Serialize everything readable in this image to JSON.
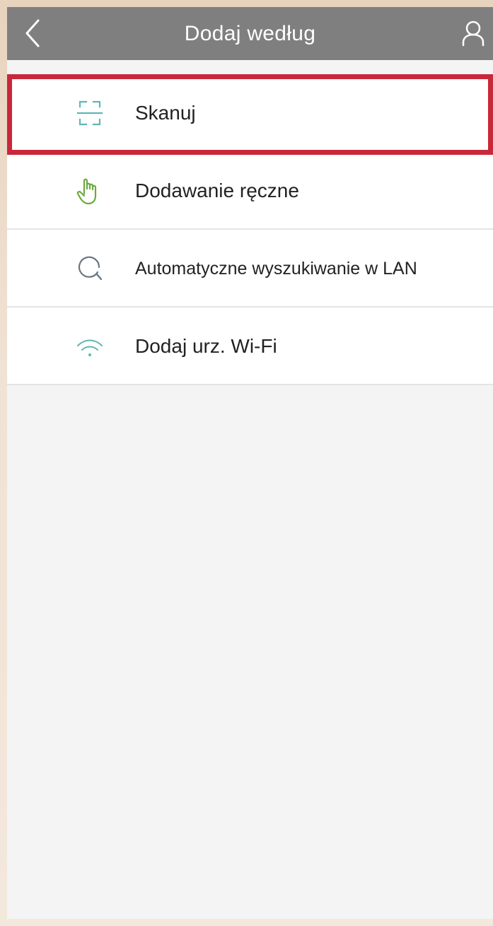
{
  "header": {
    "title": "Dodaj według",
    "back_icon": "chevron-left-icon",
    "user_icon": "user-icon"
  },
  "menu": {
    "items": [
      {
        "label": "Skanuj",
        "icon": "scan-icon",
        "highlighted": true
      },
      {
        "label": "Dodawanie ręczne",
        "icon": "hand-pointer-icon"
      },
      {
        "label": "Automatyczne wyszukiwanie w LAN",
        "icon": "lan-search-icon"
      },
      {
        "label": "Dodaj urz. Wi-Fi",
        "icon": "wifi-icon"
      }
    ]
  },
  "colors": {
    "header_bg": "#7f7f7f",
    "highlight_border": "#c8283a",
    "icon_teal": "#5fb7b3",
    "icon_green": "#6aaa3f",
    "icon_slate": "#6a7684"
  }
}
